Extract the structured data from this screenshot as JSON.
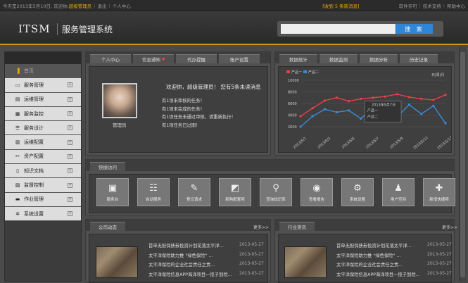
{
  "topbar": {
    "greeting": "今天是2013年5月10日, 欢迎你:",
    "admin": "超级管理员",
    "logout": "退出",
    "personal": "个人中心",
    "messages": "[收到 5 条新消息]",
    "software": "软件许可",
    "support": "技术支持",
    "help": "帮助中心"
  },
  "header": {
    "logo": "ITSM",
    "system_name": "服务管理系统",
    "search_placeholder": "",
    "search_button": "搜 索"
  },
  "sidebar": {
    "home": "首页",
    "items": [
      {
        "label": "服务管理",
        "icon": "monitor-icon"
      },
      {
        "label": "运维管理",
        "icon": "folder-icon"
      },
      {
        "label": "服务监控",
        "icon": "file-icon"
      },
      {
        "label": "服务设计",
        "icon": "database-icon"
      },
      {
        "label": "运维配置",
        "icon": "book-icon"
      },
      {
        "label": "资产配置",
        "icon": "scissors-icon"
      },
      {
        "label": "知识文档",
        "icon": "document-icon"
      },
      {
        "label": "监督控制",
        "icon": "chart-icon"
      },
      {
        "label": "作业管理",
        "icon": "briefcase-icon"
      },
      {
        "label": "系统设置",
        "icon": "gear-icon"
      }
    ]
  },
  "user_panel": {
    "tabs": [
      "个人中心",
      "信息通知",
      "代办提醒",
      "账户设置"
    ],
    "active_tab": "信息通知",
    "avatar_label": "管理员",
    "welcome": "欢迎你，超级管理员！  您有5条未读消息",
    "tasks": [
      "有1项未审核的任务！",
      "有1项未完成的任务！",
      "有1项任务未通过审核，请重新执行！",
      "有1项任务已过期！"
    ]
  },
  "stats_panel": {
    "tabs": [
      "数据统计",
      "数据监测",
      "数据分析",
      "历史记录"
    ],
    "active_tab": "数据统计",
    "period": "日|周|月",
    "tooltip_date": "2013年5月7日",
    "tooltip_a": "产品一",
    "tooltip_b": "产品二"
  },
  "chart_data": {
    "type": "line",
    "legend": [
      "产品一",
      "产品二"
    ],
    "colors": [
      "#e8404a",
      "#3a8ad6"
    ],
    "ylim": [
      2000,
      10000
    ],
    "yticks": [
      "10000",
      "8000",
      "6000",
      "4000",
      "2000"
    ],
    "x": [
      "2013/5/1",
      "2013/5/2",
      "2013/5/3",
      "2013/5/4",
      "2013/5/5",
      "2013/5/6",
      "2013/5/7",
      "2013/5/8",
      "2013/5/9",
      "2013/5/10",
      "2013/5/11",
      "2013/5/12",
      "2013/5/13"
    ],
    "series": [
      {
        "name": "产品一",
        "values": [
          3800,
          5200,
          6500,
          7000,
          6400,
          6800,
          7000,
          7200,
          7600,
          7100,
          6800,
          6600,
          7500
        ]
      },
      {
        "name": "产品二",
        "values": [
          2000,
          3800,
          5000,
          4500,
          4800,
          3400,
          5200,
          4500,
          3700,
          5800,
          4200,
          5600,
          2600
        ]
      }
    ],
    "tick_labels": [
      "2013/5/1",
      "2013/5/3",
      "2013/5/5",
      "2013/5/7",
      "2013/5/9",
      "2013/5/11",
      "2013/5/13"
    ]
  },
  "quick_panel": {
    "title": "快捷访问",
    "items": [
      {
        "label": "服务台",
        "icon": "desk-icon",
        "glyph": "▣"
      },
      {
        "label": "自动服务",
        "icon": "sliders-icon",
        "glyph": "☷"
      },
      {
        "label": "登记请求",
        "icon": "edit-icon",
        "glyph": "✎"
      },
      {
        "label": "新购配置项",
        "icon": "grid-icon",
        "glyph": "◩"
      },
      {
        "label": "查询知识库",
        "icon": "search-icon",
        "glyph": "⚲"
      },
      {
        "label": "查看报告",
        "icon": "eye-icon",
        "glyph": "◉"
      },
      {
        "label": "系统设置",
        "icon": "gear-icon",
        "glyph": "⚙"
      },
      {
        "label": "用户空间",
        "icon": "user-icon",
        "glyph": "♟"
      },
      {
        "label": "新增快捷项",
        "icon": "add-icon",
        "glyph": "✚"
      }
    ]
  },
  "news_left": {
    "title": "公司动态",
    "more": "更多>>",
    "items": [
      {
        "text": "首单无担保债券投资计划花落太平洋...",
        "date": "2013-05-27"
      },
      {
        "text": "太平洋保险助力推 \"绿色保险\" ...",
        "date": "2013-05-27"
      },
      {
        "text": "太平洋保险的企业社会责任之责...",
        "date": "2013-05-27"
      },
      {
        "text": "太平洋保险信息APP海洋项目一揽子到险...",
        "date": "2013-05-27"
      }
    ]
  },
  "news_right": {
    "title": "行业资讯",
    "more": "更多>>",
    "items": [
      {
        "text": "首单无担保债券投资计划花落太平洋...",
        "date": "2013-05-27"
      },
      {
        "text": "太平洋保险助力推 \"绿色保险\" ...",
        "date": "2013-05-27"
      },
      {
        "text": "太平洋保险的企业社会责任之责...",
        "date": "2013-05-27"
      },
      {
        "text": "太平洋保险信息APP海洋项目一揽子到险...",
        "date": "2013-05-27"
      }
    ]
  }
}
